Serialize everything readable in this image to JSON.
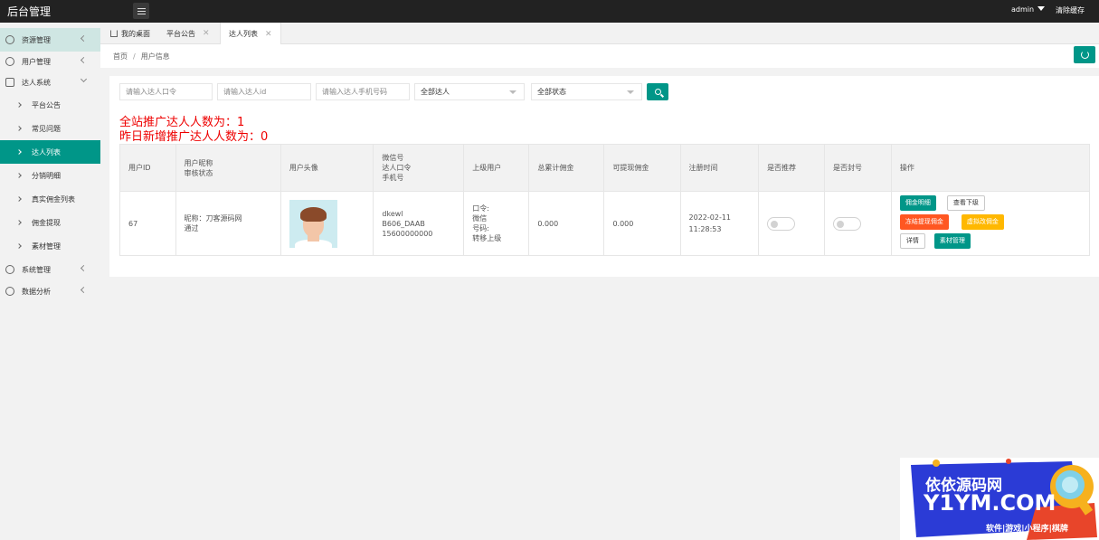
{
  "header": {
    "title": "后台管理",
    "user": "admin",
    "clear_cache": "清除缓存"
  },
  "sidebar": {
    "items": [
      {
        "label": "资源管理",
        "icon": "user-icon"
      },
      {
        "label": "用户管理",
        "icon": "face-icon"
      },
      {
        "label": "达人系统",
        "icon": "grid-icon"
      },
      {
        "label": "平台公告"
      },
      {
        "label": "常见问题"
      },
      {
        "label": "达人列表"
      },
      {
        "label": "分销明细"
      },
      {
        "label": "真实佣金列表"
      },
      {
        "label": "佣金提现"
      },
      {
        "label": "素材管理"
      },
      {
        "label": "系统管理",
        "icon": "user-icon"
      },
      {
        "label": "数据分析",
        "icon": "chart-icon"
      }
    ]
  },
  "tabs": [
    {
      "label": "我的桌面"
    },
    {
      "label": "平台公告"
    },
    {
      "label": "达人列表"
    }
  ],
  "breadcrumb": {
    "home": "首页",
    "sep": "/",
    "current": "用户信息"
  },
  "filters": {
    "code_placeholder": "请输入达人口令",
    "id_placeholder": "请输入达人id",
    "phone_placeholder": "请输入达人手机号码",
    "type_value": "全部达人",
    "status_value": "全部状态"
  },
  "stats": {
    "total": "全站推广达人人数为：1",
    "yesterday": "昨日新增推广达人人数为：0"
  },
  "table": {
    "headers": {
      "user_id": "用户ID",
      "nick_line1": "用户昵称",
      "nick_line2": "审核状态",
      "avatar": "用户头像",
      "wx_line1": "微信号",
      "wx_line2": "达人口令",
      "wx_line3": "手机号",
      "parent": "上级用户",
      "total_commission": "总累计佣金",
      "withdrawable": "可提现佣金",
      "register_time": "注册时间",
      "recommend": "是否推荐",
      "banned": "是否封号",
      "actions": "操作"
    },
    "rows": [
      {
        "user_id": "67",
        "nickname": "昵称：刀客源码网",
        "review": "通过",
        "wechat": "dkewl",
        "code": "B606_DAAB",
        "phone": "15600000000",
        "parent_code": "口令:",
        "parent_wx": "微信",
        "parent_no": "号码:",
        "parent_move": "转移上级",
        "total_commission": "0.000",
        "withdrawable": "0.000",
        "reg_date": "2022-02-11",
        "reg_time": "11:28:53",
        "recommend_on": false,
        "banned_on": false
      }
    ],
    "actions": {
      "detail": "佣金明细",
      "subordinates": "查看下级",
      "freeze": "冻结提现佣金",
      "fake": "虚拟改佣金",
      "info": "详情",
      "material": "素材管理"
    }
  },
  "watermark": {
    "line1": "依依源码网",
    "line2": "Y1YM.COM",
    "line3": "软件|游戏|小程序|棋牌"
  },
  "colors": {
    "primary": "#009688",
    "danger": "#ff5722",
    "warning": "#ffb800",
    "stat_red": "#ee0000"
  }
}
